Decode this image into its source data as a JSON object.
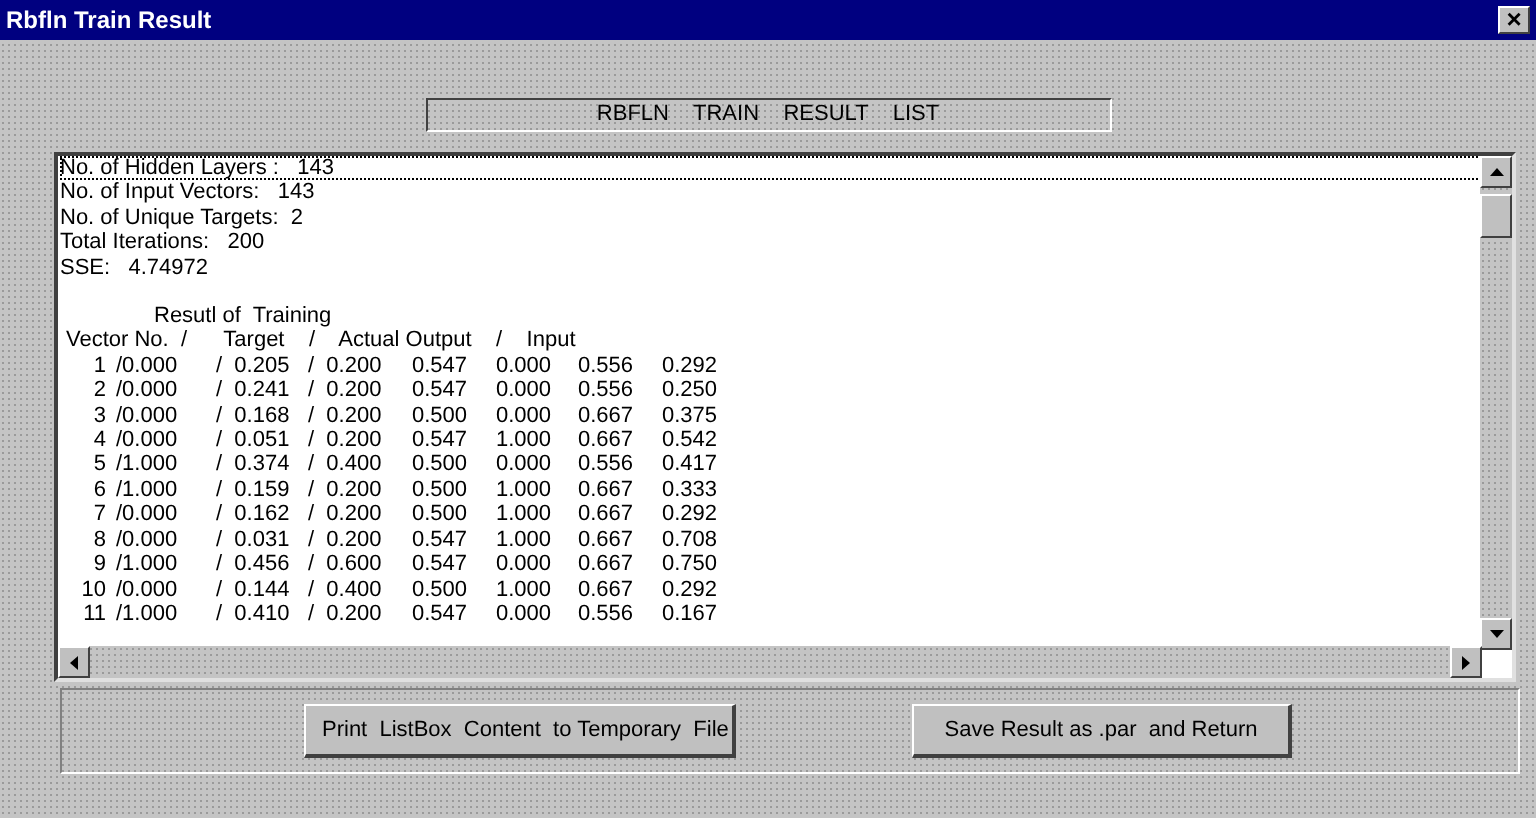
{
  "window": {
    "title": "Rbfln Train Result",
    "close": "×"
  },
  "heading": "RBFLN    TRAIN    RESULT    LIST",
  "list": {
    "info": [
      {
        "text": "No. of Hidden Layers :   143",
        "selected": true
      },
      {
        "text": "No. of Input Vectors:   143",
        "selected": false
      },
      {
        "text": "No. of Unique Targets:  2",
        "selected": false
      },
      {
        "text": "Total Iterations:   200",
        "selected": false
      },
      {
        "text": "SSE:   4.74972",
        "selected": false
      }
    ],
    "caption": "Resutl of  Training",
    "header": "Vector No.  /      Target    /    Actual Output    /    Input",
    "rows": [
      [
        "1",
        "/0.000",
        "/  0.205",
        "/  0.200",
        "0.547",
        "0.000",
        "0.556",
        "0.292"
      ],
      [
        "2",
        "/0.000",
        "/  0.241",
        "/  0.200",
        "0.547",
        "0.000",
        "0.556",
        "0.250"
      ],
      [
        "3",
        "/0.000",
        "/  0.168",
        "/  0.200",
        "0.500",
        "0.000",
        "0.667",
        "0.375"
      ],
      [
        "4",
        "/0.000",
        "/  0.051",
        "/  0.200",
        "0.547",
        "1.000",
        "0.667",
        "0.542"
      ],
      [
        "5",
        "/1.000",
        "/  0.374",
        "/  0.400",
        "0.500",
        "0.000",
        "0.556",
        "0.417"
      ],
      [
        "6",
        "/1.000",
        "/  0.159",
        "/  0.200",
        "0.500",
        "1.000",
        "0.667",
        "0.333"
      ],
      [
        "7",
        "/0.000",
        "/  0.162",
        "/  0.200",
        "0.500",
        "1.000",
        "0.667",
        "0.292"
      ],
      [
        "8",
        "/0.000",
        "/  0.031",
        "/  0.200",
        "0.547",
        "1.000",
        "0.667",
        "0.708"
      ],
      [
        "9",
        "/1.000",
        "/  0.456",
        "/  0.600",
        "0.547",
        "0.000",
        "0.667",
        "0.750"
      ],
      [
        "10",
        "/0.000",
        "/  0.144",
        "/  0.400",
        "0.500",
        "1.000",
        "0.667",
        "0.292"
      ],
      [
        "11",
        "/1.000",
        "/  0.410",
        "/  0.200",
        "0.547",
        "0.000",
        "0.556",
        "0.167"
      ]
    ]
  },
  "buttons": [
    "Print  ListBox  Content  to Temporary  File",
    "Save Result as .par  and Return"
  ]
}
